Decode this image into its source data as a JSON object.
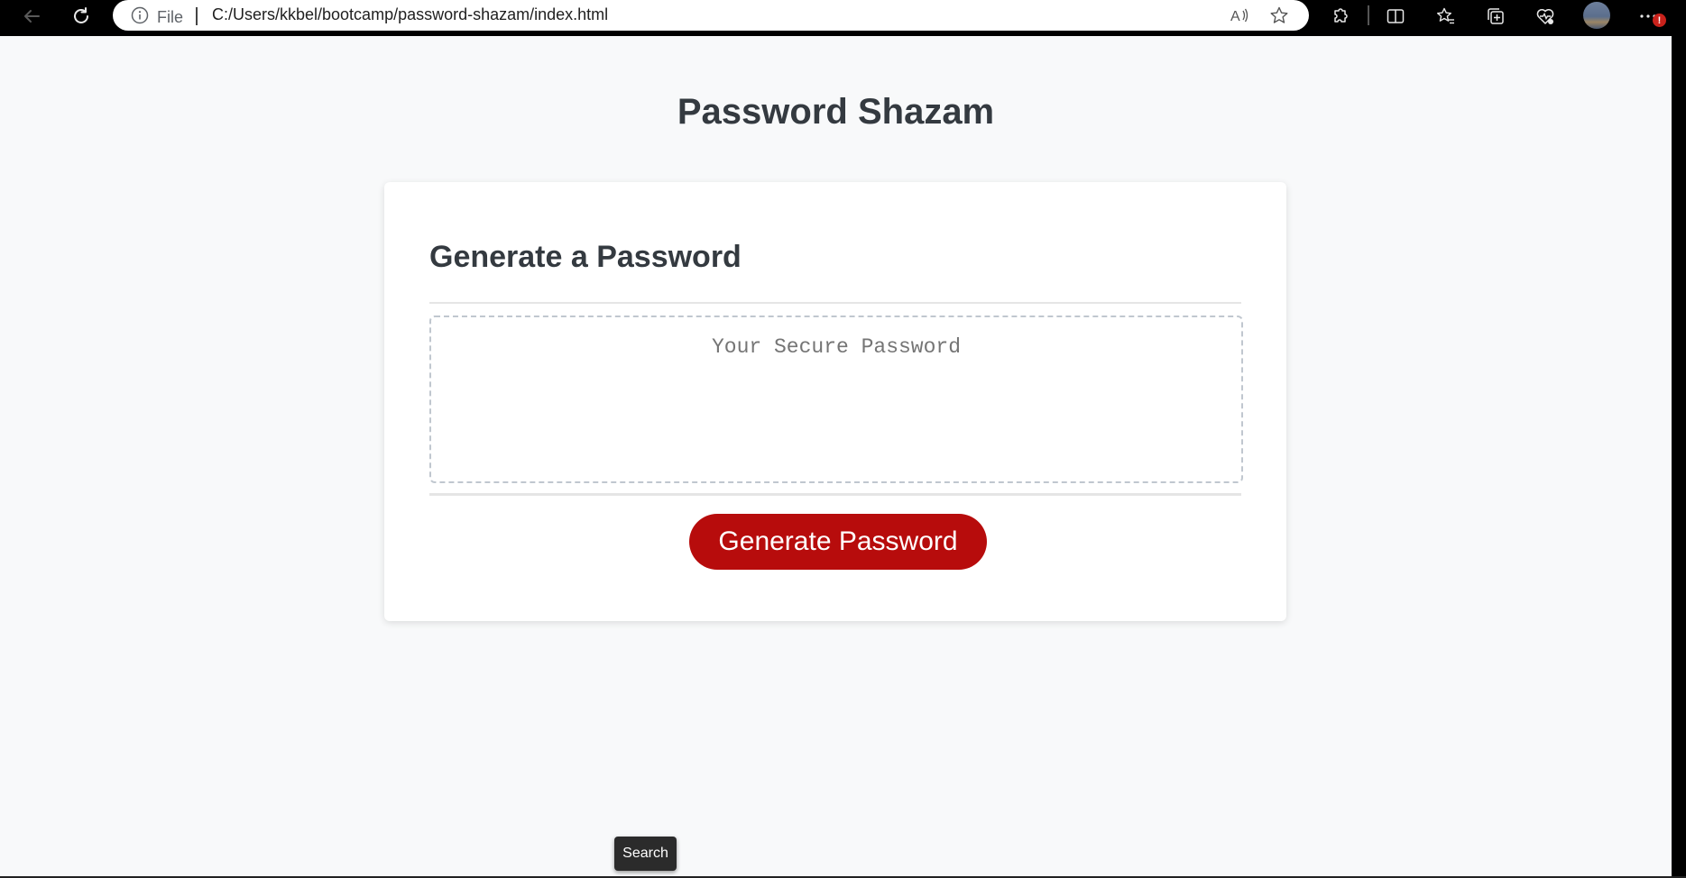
{
  "browser": {
    "site_info_label": "File",
    "url": "C:/Users/kkbel/bootcamp/password-shazam/index.html",
    "notification_badge": "!"
  },
  "page": {
    "title": "Password Shazam",
    "card": {
      "title": "Generate a Password",
      "password_placeholder": "Your Secure Password",
      "password_value": "",
      "generate_button_label": "Generate Password"
    }
  },
  "tooltip": {
    "text": "Search"
  },
  "colors": {
    "page_background": "#f8f9fa",
    "heading_text": "#343a40",
    "button_red": "#b70c0c"
  }
}
